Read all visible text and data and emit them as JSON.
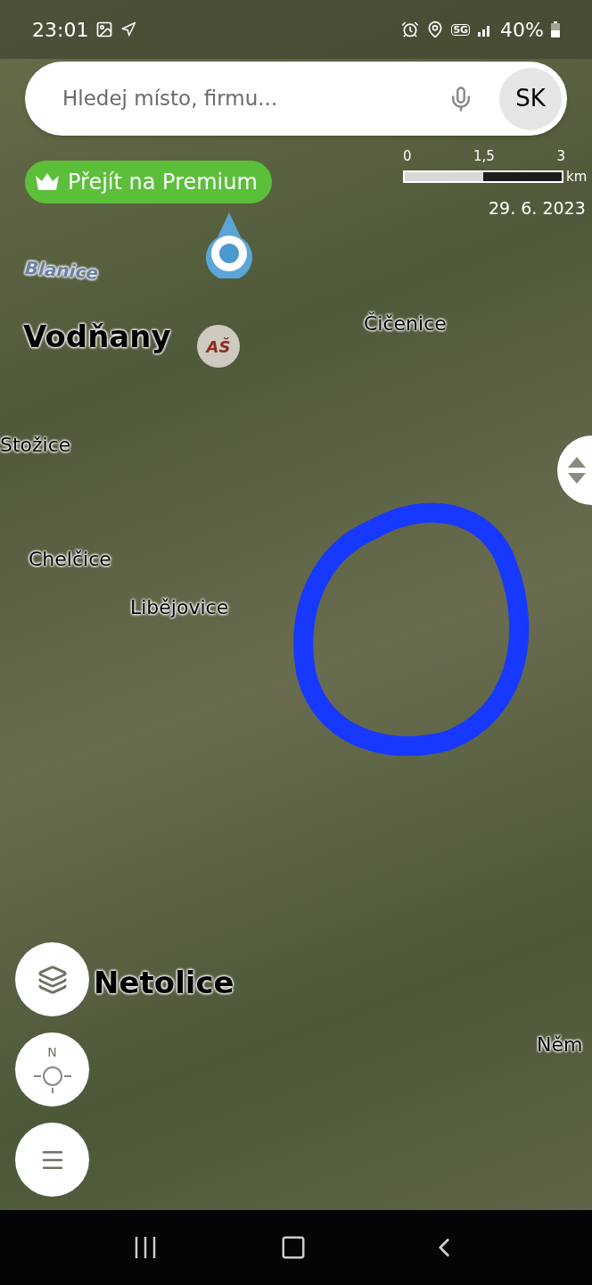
{
  "status_bar": {
    "time": "23:01",
    "network": "5G",
    "battery": "40%"
  },
  "search": {
    "placeholder": "Hledej místo, firmu...",
    "avatar": "SK"
  },
  "premium_button": {
    "label": "Přejít na Premium"
  },
  "scale": {
    "ticks": [
      "0",
      "1,5",
      "3"
    ],
    "unit": "km"
  },
  "imagery_date": "29. 6. 2023",
  "poi": {
    "logo": "AŠ"
  },
  "place_labels": [
    {
      "name": "Blanice",
      "kind": "river"
    },
    {
      "name": "Vodňany",
      "kind": "town"
    },
    {
      "name": "Čičenice",
      "kind": "village"
    },
    {
      "name": "Stožice",
      "kind": "village"
    },
    {
      "name": "Chelčice",
      "kind": "village"
    },
    {
      "name": "Libějovice",
      "kind": "village"
    },
    {
      "name": "Netolice",
      "kind": "town"
    },
    {
      "name": "Něm",
      "kind": "village"
    }
  ],
  "compass": {
    "label": "N"
  }
}
